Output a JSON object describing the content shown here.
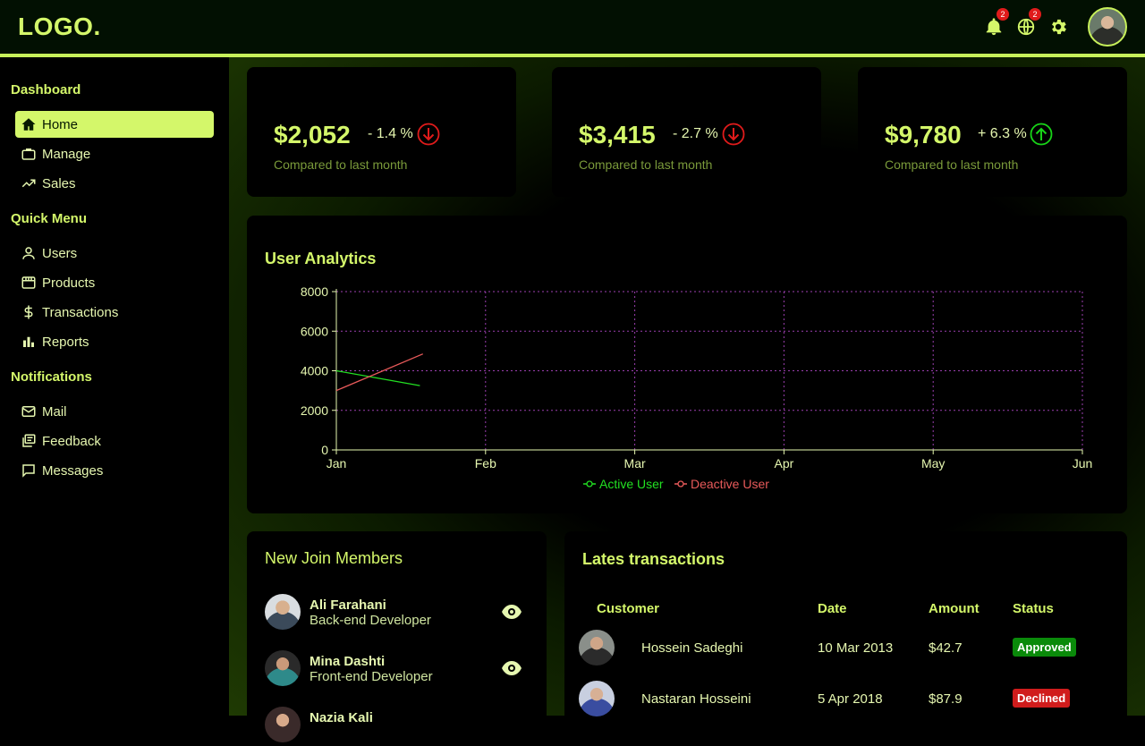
{
  "header": {
    "logo": "LOGO.",
    "notifications_badge": "2",
    "language_badge": "2",
    "icons": [
      "bell-icon",
      "globe-icon",
      "gear-icon",
      "avatar"
    ]
  },
  "sidebar": {
    "sections": [
      {
        "title": "Dashboard",
        "items": [
          {
            "label": "Home",
            "icon": "home-icon",
            "active": true
          },
          {
            "label": "Manage",
            "icon": "briefcase-icon"
          },
          {
            "label": "Sales",
            "icon": "trend-icon"
          }
        ]
      },
      {
        "title": "Quick Menu",
        "items": [
          {
            "label": "Users",
            "icon": "user-icon"
          },
          {
            "label": "Products",
            "icon": "store-icon"
          },
          {
            "label": "Transactions",
            "icon": "dollar-icon"
          },
          {
            "label": "Reports",
            "icon": "bar-chart-icon"
          }
        ]
      },
      {
        "title": "Notifications",
        "items": [
          {
            "label": "Mail",
            "icon": "mail-icon"
          },
          {
            "label": "Feedback",
            "icon": "feedback-icon"
          },
          {
            "label": "Messages",
            "icon": "message-icon"
          }
        ]
      }
    ]
  },
  "stats": [
    {
      "value": "$2,052",
      "delta": "- 1.4 %",
      "direction": "down",
      "note": "Compared to last month"
    },
    {
      "value": "$3,415",
      "delta": "- 2.7 %",
      "direction": "down",
      "note": "Compared to last month"
    },
    {
      "value": "$9,780",
      "delta": "+ 6.3 %",
      "direction": "up",
      "note": "Compared to last month"
    }
  ],
  "analytics": {
    "title": "User Analytics"
  },
  "chart_data": {
    "type": "line",
    "x": [
      "Jan",
      "Feb",
      "Mar",
      "Apr",
      "May",
      "Jun"
    ],
    "ylim": [
      0,
      8000
    ],
    "yticks": [
      0,
      2000,
      4000,
      6000,
      8000
    ],
    "grid": true,
    "legend": "bottom",
    "series": [
      {
        "name": "Active User",
        "color": "#22e022",
        "points": [
          [
            0,
            4000
          ],
          [
            0.56,
            3250
          ]
        ]
      },
      {
        "name": "Deactive User",
        "color": "#e85a5a",
        "points": [
          [
            0,
            3000
          ],
          [
            0.58,
            4850
          ]
        ]
      }
    ]
  },
  "members": {
    "title": "New Join Members",
    "items": [
      {
        "name": "Ali Farahani",
        "role": "Back-end Developer"
      },
      {
        "name": "Mina Dashti",
        "role": "Front-end Developer"
      },
      {
        "name": "Nazia Kali",
        "role": ""
      }
    ]
  },
  "transactions": {
    "title": "Lates transactions",
    "headers": [
      "Customer",
      "Date",
      "Amount",
      "Status"
    ],
    "rows": [
      {
        "customer": "Hossein Sadeghi",
        "date": "10 Mar 2013",
        "amount": "$42.7",
        "status": "Approved",
        "status_color": "#0a8a0a"
      },
      {
        "customer": "Nastaran Hosseini",
        "date": "5 Apr 2018",
        "amount": "$87.9",
        "status": "Declined",
        "status_color": "#d01c1c"
      }
    ]
  }
}
